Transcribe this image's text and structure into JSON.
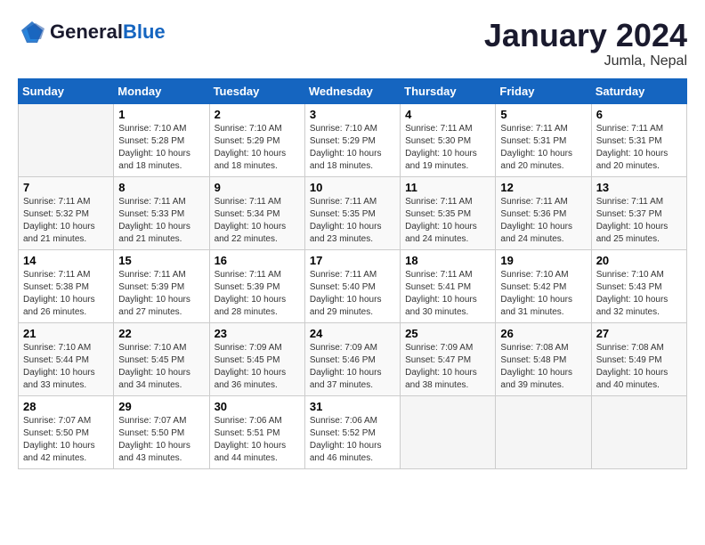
{
  "header": {
    "logo_general": "General",
    "logo_blue": "Blue",
    "title": "January 2024",
    "subtitle": "Jumla, Nepal"
  },
  "days_of_week": [
    "Sunday",
    "Monday",
    "Tuesday",
    "Wednesday",
    "Thursday",
    "Friday",
    "Saturday"
  ],
  "weeks": [
    [
      {
        "day": "",
        "sunrise": "",
        "sunset": "",
        "daylight": ""
      },
      {
        "day": "1",
        "sunrise": "7:10 AM",
        "sunset": "5:28 PM",
        "daylight": "10 hours and 18 minutes."
      },
      {
        "day": "2",
        "sunrise": "7:10 AM",
        "sunset": "5:29 PM",
        "daylight": "10 hours and 18 minutes."
      },
      {
        "day": "3",
        "sunrise": "7:10 AM",
        "sunset": "5:29 PM",
        "daylight": "10 hours and 18 minutes."
      },
      {
        "day": "4",
        "sunrise": "7:11 AM",
        "sunset": "5:30 PM",
        "daylight": "10 hours and 19 minutes."
      },
      {
        "day": "5",
        "sunrise": "7:11 AM",
        "sunset": "5:31 PM",
        "daylight": "10 hours and 20 minutes."
      },
      {
        "day": "6",
        "sunrise": "7:11 AM",
        "sunset": "5:31 PM",
        "daylight": "10 hours and 20 minutes."
      }
    ],
    [
      {
        "day": "7",
        "sunrise": "7:11 AM",
        "sunset": "5:32 PM",
        "daylight": "10 hours and 21 minutes."
      },
      {
        "day": "8",
        "sunrise": "7:11 AM",
        "sunset": "5:33 PM",
        "daylight": "10 hours and 21 minutes."
      },
      {
        "day": "9",
        "sunrise": "7:11 AM",
        "sunset": "5:34 PM",
        "daylight": "10 hours and 22 minutes."
      },
      {
        "day": "10",
        "sunrise": "7:11 AM",
        "sunset": "5:35 PM",
        "daylight": "10 hours and 23 minutes."
      },
      {
        "day": "11",
        "sunrise": "7:11 AM",
        "sunset": "5:35 PM",
        "daylight": "10 hours and 24 minutes."
      },
      {
        "day": "12",
        "sunrise": "7:11 AM",
        "sunset": "5:36 PM",
        "daylight": "10 hours and 24 minutes."
      },
      {
        "day": "13",
        "sunrise": "7:11 AM",
        "sunset": "5:37 PM",
        "daylight": "10 hours and 25 minutes."
      }
    ],
    [
      {
        "day": "14",
        "sunrise": "7:11 AM",
        "sunset": "5:38 PM",
        "daylight": "10 hours and 26 minutes."
      },
      {
        "day": "15",
        "sunrise": "7:11 AM",
        "sunset": "5:39 PM",
        "daylight": "10 hours and 27 minutes."
      },
      {
        "day": "16",
        "sunrise": "7:11 AM",
        "sunset": "5:39 PM",
        "daylight": "10 hours and 28 minutes."
      },
      {
        "day": "17",
        "sunrise": "7:11 AM",
        "sunset": "5:40 PM",
        "daylight": "10 hours and 29 minutes."
      },
      {
        "day": "18",
        "sunrise": "7:11 AM",
        "sunset": "5:41 PM",
        "daylight": "10 hours and 30 minutes."
      },
      {
        "day": "19",
        "sunrise": "7:10 AM",
        "sunset": "5:42 PM",
        "daylight": "10 hours and 31 minutes."
      },
      {
        "day": "20",
        "sunrise": "7:10 AM",
        "sunset": "5:43 PM",
        "daylight": "10 hours and 32 minutes."
      }
    ],
    [
      {
        "day": "21",
        "sunrise": "7:10 AM",
        "sunset": "5:44 PM",
        "daylight": "10 hours and 33 minutes."
      },
      {
        "day": "22",
        "sunrise": "7:10 AM",
        "sunset": "5:45 PM",
        "daylight": "10 hours and 34 minutes."
      },
      {
        "day": "23",
        "sunrise": "7:09 AM",
        "sunset": "5:45 PM",
        "daylight": "10 hours and 36 minutes."
      },
      {
        "day": "24",
        "sunrise": "7:09 AM",
        "sunset": "5:46 PM",
        "daylight": "10 hours and 37 minutes."
      },
      {
        "day": "25",
        "sunrise": "7:09 AM",
        "sunset": "5:47 PM",
        "daylight": "10 hours and 38 minutes."
      },
      {
        "day": "26",
        "sunrise": "7:08 AM",
        "sunset": "5:48 PM",
        "daylight": "10 hours and 39 minutes."
      },
      {
        "day": "27",
        "sunrise": "7:08 AM",
        "sunset": "5:49 PM",
        "daylight": "10 hours and 40 minutes."
      }
    ],
    [
      {
        "day": "28",
        "sunrise": "7:07 AM",
        "sunset": "5:50 PM",
        "daylight": "10 hours and 42 minutes."
      },
      {
        "day": "29",
        "sunrise": "7:07 AM",
        "sunset": "5:50 PM",
        "daylight": "10 hours and 43 minutes."
      },
      {
        "day": "30",
        "sunrise": "7:06 AM",
        "sunset": "5:51 PM",
        "daylight": "10 hours and 44 minutes."
      },
      {
        "day": "31",
        "sunrise": "7:06 AM",
        "sunset": "5:52 PM",
        "daylight": "10 hours and 46 minutes."
      },
      {
        "day": "",
        "sunrise": "",
        "sunset": "",
        "daylight": ""
      },
      {
        "day": "",
        "sunrise": "",
        "sunset": "",
        "daylight": ""
      },
      {
        "day": "",
        "sunrise": "",
        "sunset": "",
        "daylight": ""
      }
    ]
  ],
  "labels": {
    "sunrise": "Sunrise:",
    "sunset": "Sunset:",
    "daylight": "Daylight:"
  }
}
